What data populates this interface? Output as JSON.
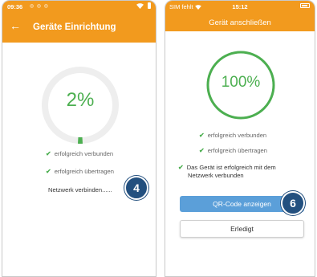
{
  "left_screen": {
    "status_time": "09:36",
    "status_small_icons": "◎ ◎ ◎",
    "title": "Geräte Einrichtung",
    "progress": {
      "label": "2%",
      "fraction": 0.02
    },
    "status_lines": [
      "erfolgreich verbunden",
      "erfolgreich übertragen"
    ],
    "network_text": "Netzwerk verbinden......",
    "step_badge": "4"
  },
  "right_screen": {
    "carrier": "SIM fehlt",
    "status_time": "15:12",
    "title": "Gerät anschließen",
    "progress": {
      "label": "100%",
      "fraction": 1.0
    },
    "status_lines": [
      "erfolgreich verbunden",
      "erfolgreich übertragen"
    ],
    "network_success_line1": "Das Gerät ist erfolgreich mit dem",
    "network_success_line2": "Netzwerk verbunden",
    "qr_button_label": "QR-Code anzeigen",
    "done_button_label": "Erledigt",
    "step_badge": "6"
  },
  "colors": {
    "header": "#f29a1e",
    "success": "#4caf50",
    "primary_button": "#5b9fd9",
    "badge": "#23507f",
    "ring_track": "#eeeeee"
  },
  "icons": {
    "back": "left-arrow-icon",
    "check": "check-icon",
    "wifi": "wifi-icon",
    "battery": "battery-icon"
  }
}
